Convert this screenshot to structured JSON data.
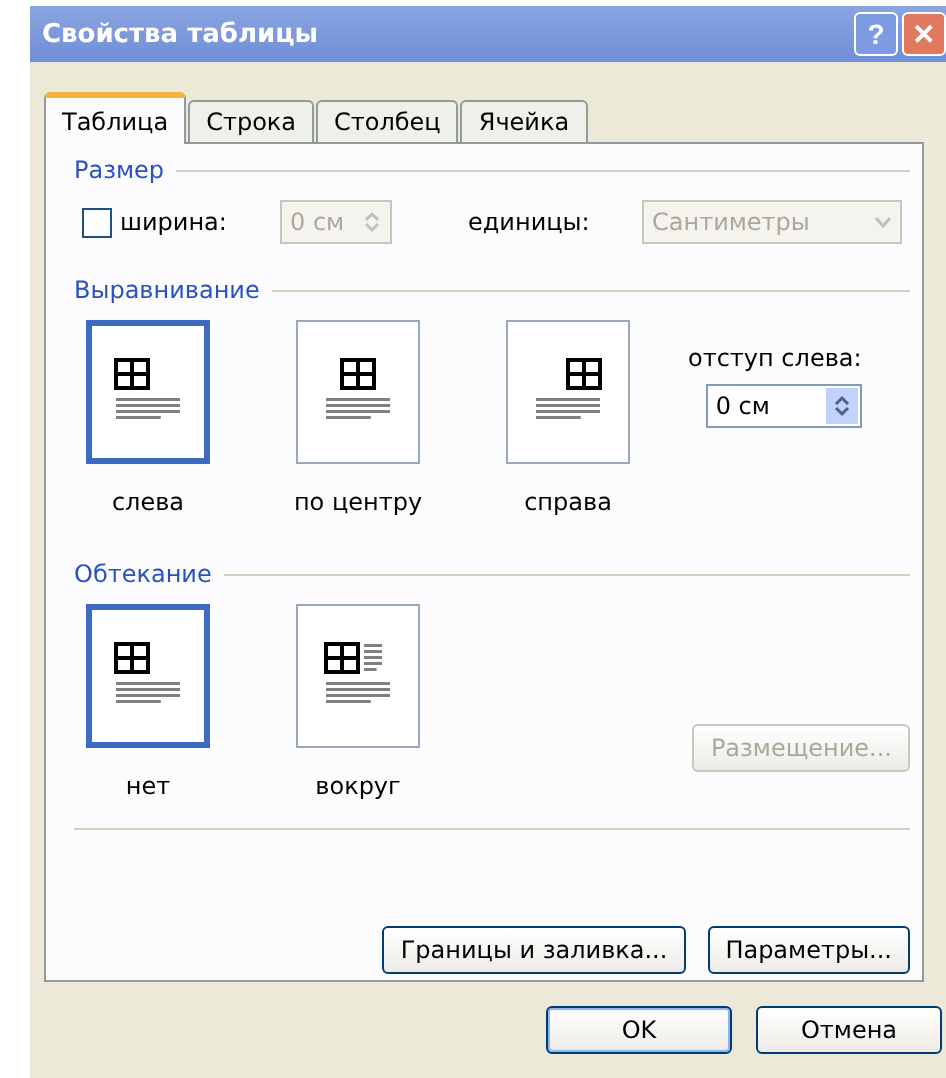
{
  "window": {
    "title": "Свойства таблицы",
    "buttons": [
      {
        "kind": "help",
        "label": "?"
      },
      {
        "kind": "close",
        "label": "✕"
      }
    ]
  },
  "tabs": [
    {
      "label": "Таблица",
      "selected": true
    },
    {
      "label": "Строка",
      "selected": false
    },
    {
      "label": "Столбец",
      "selected": false
    },
    {
      "label": "Ячейка",
      "selected": false
    }
  ],
  "size": {
    "title": "Размер",
    "width_checkbox": {
      "label": "ширина:",
      "checked": false
    },
    "width_field": {
      "value": "0 см",
      "disabled": true
    },
    "units_label": "единицы:",
    "units_select": {
      "value": "Сантиметры",
      "disabled": true
    }
  },
  "alignment": {
    "title": "Выравнивание",
    "options": [
      {
        "kind": "left",
        "label": "слева",
        "selected": true
      },
      {
        "kind": "center",
        "label": "по центру",
        "selected": false
      },
      {
        "kind": "right",
        "label": "справа",
        "selected": false
      }
    ],
    "indent_label": "отступ слева:",
    "indent_field": {
      "value": "0 см",
      "disabled": false
    }
  },
  "wrapping": {
    "title": "Обтекание",
    "options": [
      {
        "kind": "none",
        "label": "нет",
        "selected": true
      },
      {
        "kind": "around",
        "label": "вокруг",
        "selected": false
      }
    ],
    "positioning_button": {
      "label": "Размещение...",
      "disabled": true
    }
  },
  "panel_buttons": [
    "Границы и заливка...",
    "Параметры..."
  ],
  "dialog_buttons": [
    {
      "label": "OK",
      "default": true
    },
    {
      "label": "Отмена",
      "default": false
    }
  ]
}
